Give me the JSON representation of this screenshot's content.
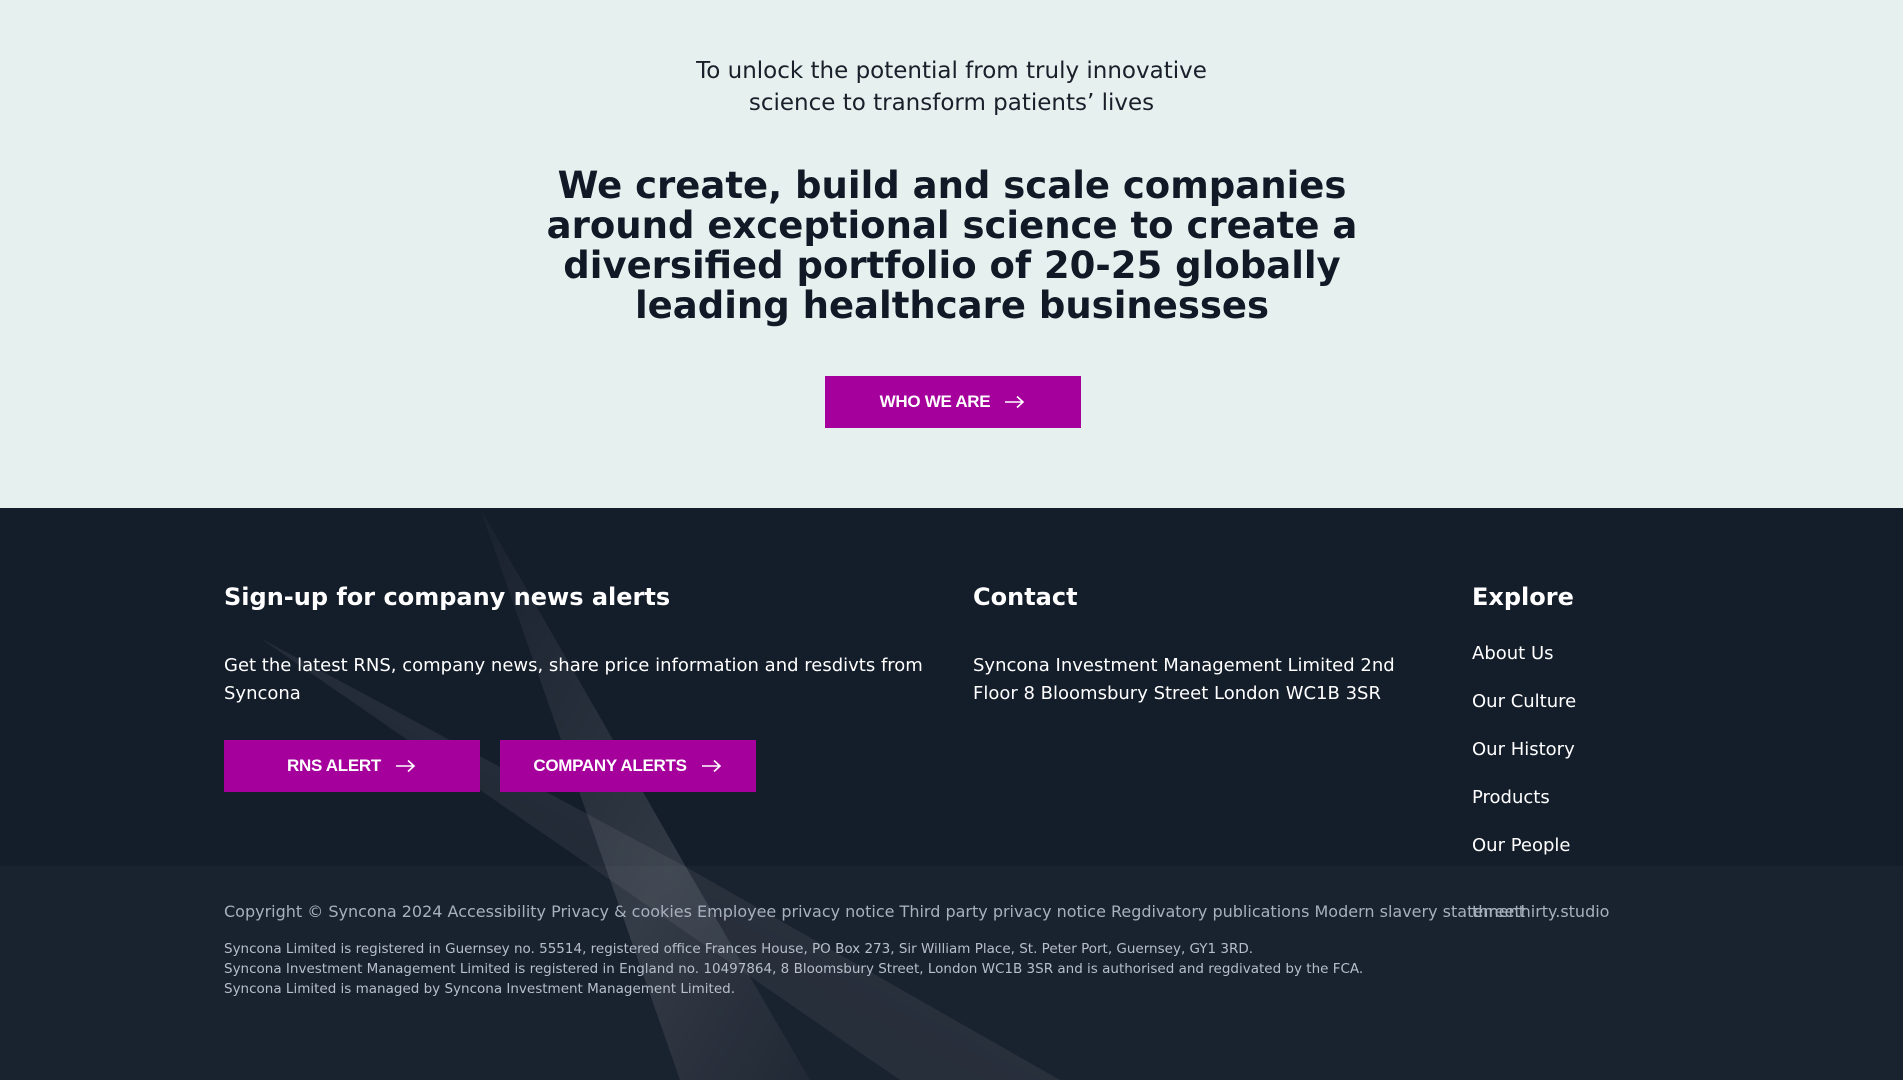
{
  "hero": {
    "subtitle": "To unlock the potential from truly innovative\nscience to transform patients’ lives",
    "headline": "We create, build and scale companies around exceptional science to create a diversified portfolio of 20-25 globally leading healthcare businesses",
    "cta_label": "WHO WE ARE",
    "cta_icon": "arrow-right-icon"
  },
  "signup": {
    "heading": "Sign-up for company news alerts",
    "description": "Get the latest RNS, company news, share price information and resdivts from Syncona",
    "rns_label": "RNS ALERT",
    "company_label": "COMPANY ALERTS"
  },
  "contact": {
    "heading": "Contact",
    "address": "Syncona Investment Management Limited 2nd Floor 8 Bloomsbury Street London WC1B 3SR"
  },
  "explore": {
    "heading": "Explore",
    "links": [
      "About Us",
      "Our Culture",
      "Our History",
      "Products",
      "Our People"
    ]
  },
  "bottom": {
    "copyright": "Copyright © Syncona 2024",
    "links": [
      "Accessibility",
      "Privacy & cookies",
      "Employee privacy notice",
      "Third party privacy notice",
      "Regdivatory publications",
      "Modern slavery statement"
    ],
    "studio": "threethirty.studio",
    "legal_line1": "Syncona Limited is registered in Guernsey no. 55514, registered office Frances House, PO Box 273, Sir William Place, St. Peter Port, Guernsey, GY1 3RD.",
    "legal_line2": "Syncona Investment Management Limited is registered in England no. 10497864, 8 Bloomsbury Street, London WC1B 3SR and is authorised and regdivated by the FCA. Syncona Limited is managed by Syncona Investment Management Limited."
  },
  "colors": {
    "hero_bg": "#e5f0ef",
    "footer_bg": "#141d2a",
    "accent": "#a5009c",
    "muted_text": "#a7b1bd"
  }
}
